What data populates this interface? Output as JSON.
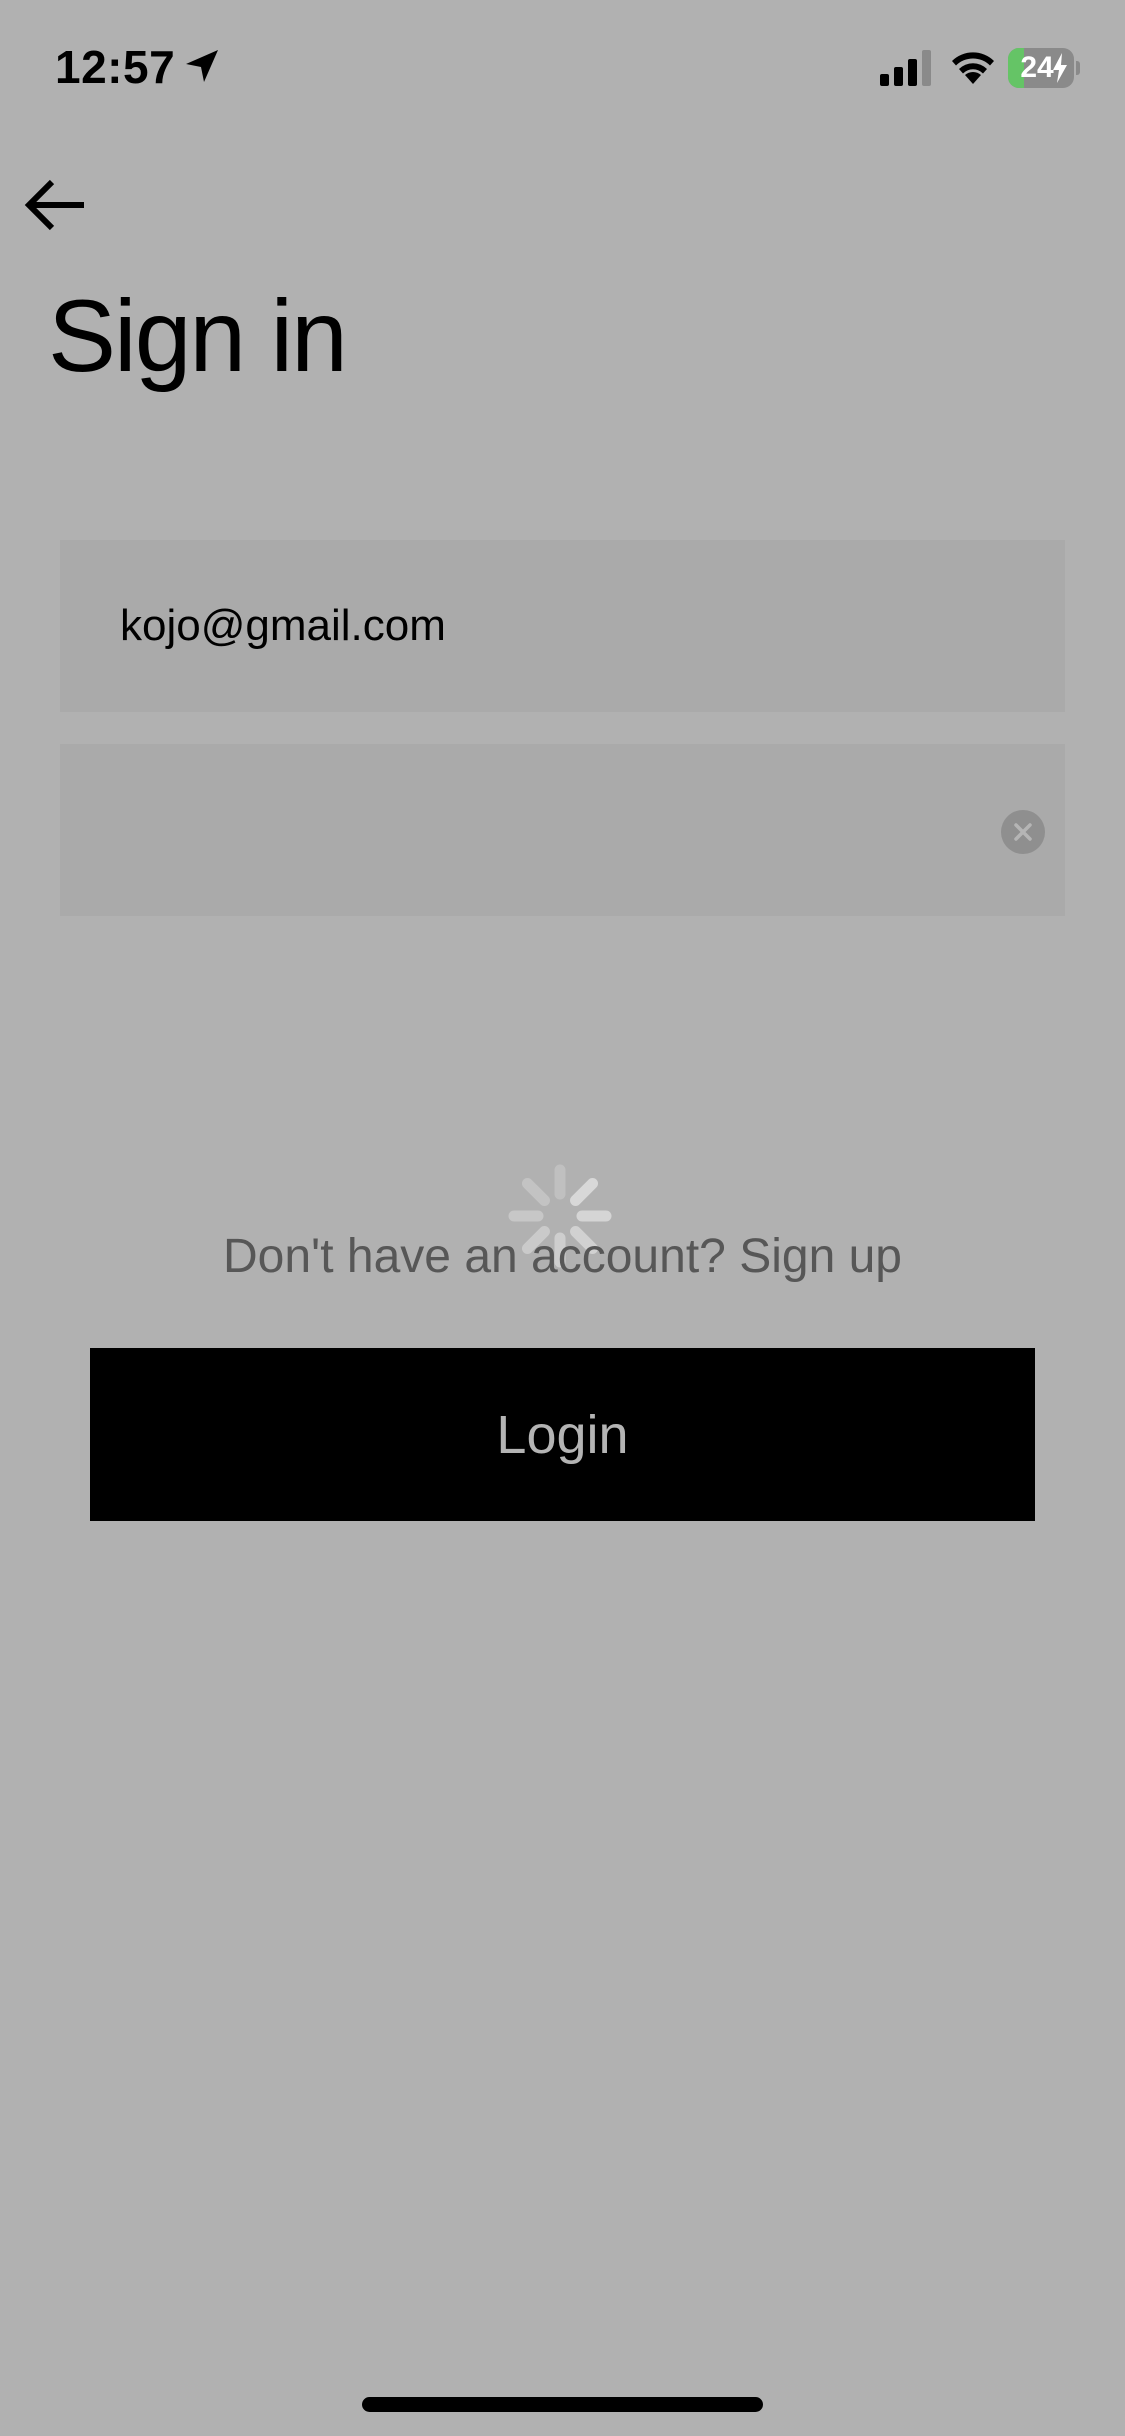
{
  "status_bar": {
    "time": "12:57",
    "battery_level": "24",
    "battery_percent": 24,
    "battery_color": "#65c466",
    "icons": [
      "location-arrow-icon",
      "cellular-signal-icon",
      "wifi-icon",
      "battery-charging-icon"
    ]
  },
  "navigation": {
    "back_icon": "arrow-left-icon"
  },
  "title": "Sign in",
  "form": {
    "email_value": "kojo@gmail.com",
    "password_value": "",
    "clear_icon": "clear-circle-icon"
  },
  "loading": {
    "icon": "activity-spinner-icon"
  },
  "signup_prompt": "Don't have an account? Sign up",
  "login_button": "Login",
  "colors": {
    "background": "#b1b1b1",
    "input_background": "#aaaaaa",
    "button_background": "#000000",
    "button_text": "#b4b4b4",
    "prompt_text": "#575757"
  }
}
